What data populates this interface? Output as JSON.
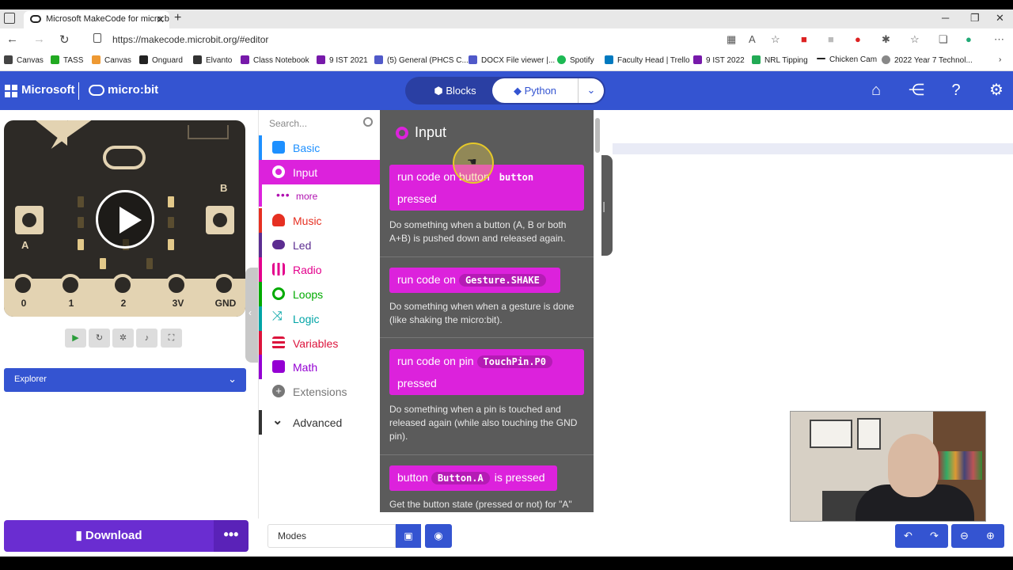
{
  "browser": {
    "tab_title": "Microsoft MakeCode for micro:b",
    "url": "https://makecode.microbit.org/#editor",
    "bookmarks": [
      "Canvas",
      "TASS",
      "Canvas",
      "Onguard",
      "Elvanto",
      "Class Notebook",
      "9 IST 2021",
      "(5) General (PHCS C...",
      "DOCX File viewer |...",
      "Spotify",
      "Faculty Head | Trello",
      "9 IST 2022",
      "NRL Tipping",
      "Chicken Cam",
      "2022 Year 7 Technol..."
    ]
  },
  "header": {
    "brand": "Microsoft",
    "product": "micro:bit",
    "blocks_label": "Blocks",
    "python_label": "Python",
    "icons": [
      "home-icon",
      "share-icon",
      "help-icon",
      "settings-icon"
    ]
  },
  "simulator": {
    "pins": [
      "0",
      "1",
      "2",
      "3V",
      "GND"
    ],
    "button_a": "A",
    "button_b": "B",
    "explorer_label": "Explorer"
  },
  "toolbox": {
    "search_placeholder": "Search...",
    "categories": [
      {
        "label": "Basic",
        "color": "#1e90ff"
      },
      {
        "label": "Input",
        "color": "#dc22dc"
      },
      {
        "label": "more",
        "color": "#dc22dc"
      },
      {
        "label": "Music",
        "color": "#e63022"
      },
      {
        "label": "Led",
        "color": "#5c2d91"
      },
      {
        "label": "Radio",
        "color": "#e3008c"
      },
      {
        "label": "Loops",
        "color": "#00aa00"
      },
      {
        "label": "Logic",
        "color": "#00a4a6"
      },
      {
        "label": "Variables",
        "color": "#dc143c"
      },
      {
        "label": "Math",
        "color": "#9400d3"
      },
      {
        "label": "Extensions",
        "color": "#777777"
      },
      {
        "label": "Advanced",
        "color": "#333333"
      }
    ]
  },
  "flyout": {
    "title": "Input",
    "blocks": [
      {
        "line1": "run code on button",
        "param": "button",
        "line2": "pressed",
        "desc": "Do something when a button (A, B or both A+B) is pushed down and released again."
      },
      {
        "line1": "run code on",
        "param": "Gesture.SHAKE",
        "line2": "",
        "desc": "Do something when when a gesture is done (like shaking the micro:bit)."
      },
      {
        "line1": "run code on pin",
        "param": "TouchPin.P0",
        "line2": "pressed",
        "desc": "Do something when a pin is touched and released again (while also touching the GND pin)."
      },
      {
        "line1": "button",
        "param": "Button.A",
        "line2": "is pressed",
        "desc": "Get the button state (pressed or not) for \"A\""
      }
    ]
  },
  "bottom": {
    "download_label": "Download",
    "project_name": "Modes"
  }
}
